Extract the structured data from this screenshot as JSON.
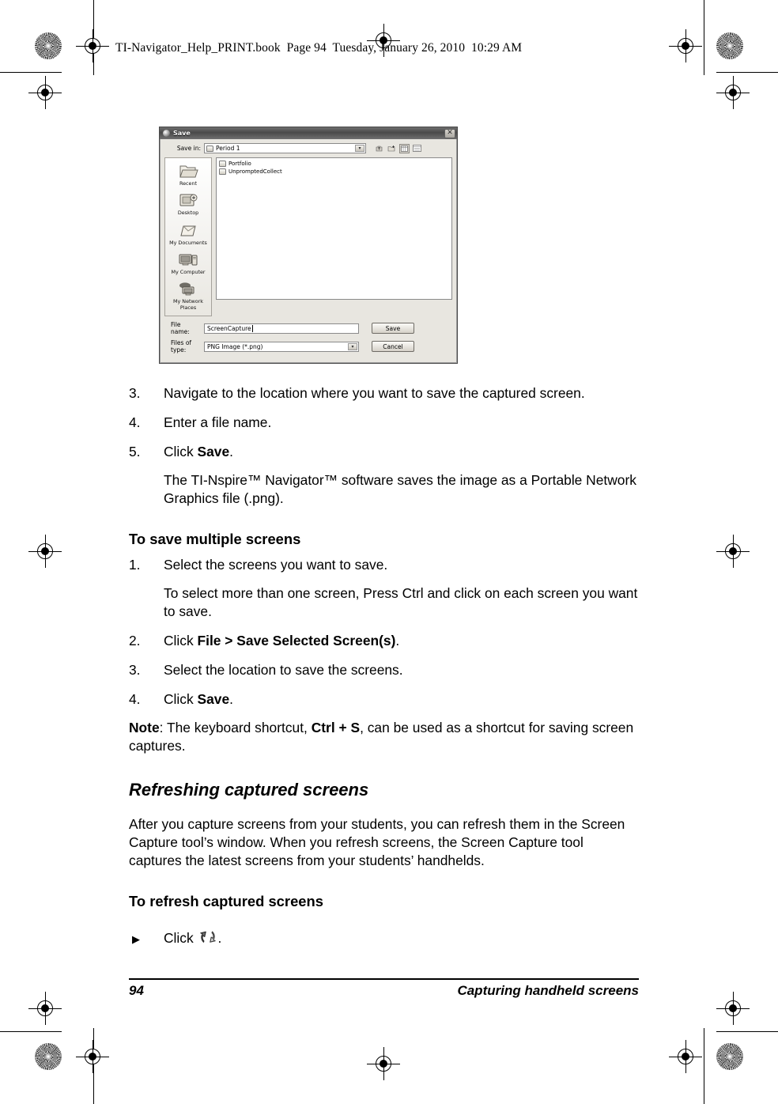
{
  "header": {
    "running_head": "TI-Navigator_Help_PRINT.book  Page 94  Tuesday, January 26, 2010  10:29 AM"
  },
  "dialog": {
    "title": "Save",
    "title_icon": "disc-icon",
    "close_label": "✕",
    "save_in_label": "Save in:",
    "save_in_value": "Period 1",
    "dropdown_caret": "▾",
    "toolbar_icons": [
      {
        "name": "up-one-level-icon"
      },
      {
        "name": "create-new-folder-icon"
      },
      {
        "name": "list-view-icon"
      },
      {
        "name": "details-view-icon"
      }
    ],
    "places": [
      {
        "label": "Recent",
        "icon": "recent-folder-icon"
      },
      {
        "label": "Desktop",
        "icon": "desktop-icon"
      },
      {
        "label": "My Documents",
        "icon": "my-documents-icon"
      },
      {
        "label": "My Computer",
        "icon": "my-computer-icon"
      },
      {
        "label": "My Network Places",
        "icon": "my-network-places-icon"
      }
    ],
    "files": [
      {
        "name": "Portfolio",
        "icon": "folder-icon"
      },
      {
        "name": "UnpromptedCollect",
        "icon": "folder-icon"
      }
    ],
    "file_name_label": "File name:",
    "file_name_value": "ScreenCapture",
    "files_of_type_label": "Files of type:",
    "files_of_type_value": "PNG Image (*.png)",
    "save_button": "Save",
    "cancel_button": "Cancel"
  },
  "body": {
    "step3_num": "3.",
    "step3_text": "Navigate to the location where you want to save the captured screen.",
    "step4_num": "4.",
    "step4_text": "Enter a file name.",
    "step5_num": "5.",
    "step5_prefix": "Click ",
    "step5_bold": "Save",
    "step5_suffix": ".",
    "step5_para": "The TI-Nspire™ Navigator™ software saves the image as a Portable Network Graphics file (.png).",
    "heading_save_multiple": "To save multiple screens",
    "m1_num": "1.",
    "m1_text": "Select the screens you want to save.",
    "m1_para": "To select more than one screen, Press Ctrl and click on each screen you want to save.",
    "m2_num": "2.",
    "m2_prefix": "Click ",
    "m2_bold": "File > Save Selected Screen(s)",
    "m2_suffix": ".",
    "m3_num": "3.",
    "m3_text": "Select the location to save the screens.",
    "m4_num": "4.",
    "m4_prefix": "Click ",
    "m4_bold": "Save",
    "m4_suffix": ".",
    "note_bold": "Note",
    "note_mid": ": The keyboard shortcut, ",
    "note_bold2": "Ctrl + S",
    "note_end": ", can be used as a shortcut for saving screen captures.",
    "heading_refreshing": "Refreshing captured screens",
    "refresh_para": "After you capture screens from your students, you can refresh them in the Screen Capture tool’s window. When you refresh screens, the Screen Capture tool captures the latest screens from your students’ handhelds.",
    "heading_to_refresh": "To refresh captured screens",
    "bullet_mark": "▶",
    "bullet_click": "Click",
    "bullet_icon": "refresh-icon",
    "bullet_period": "."
  },
  "footer": {
    "page_number": "94",
    "section_title": "Capturing handheld screens"
  }
}
